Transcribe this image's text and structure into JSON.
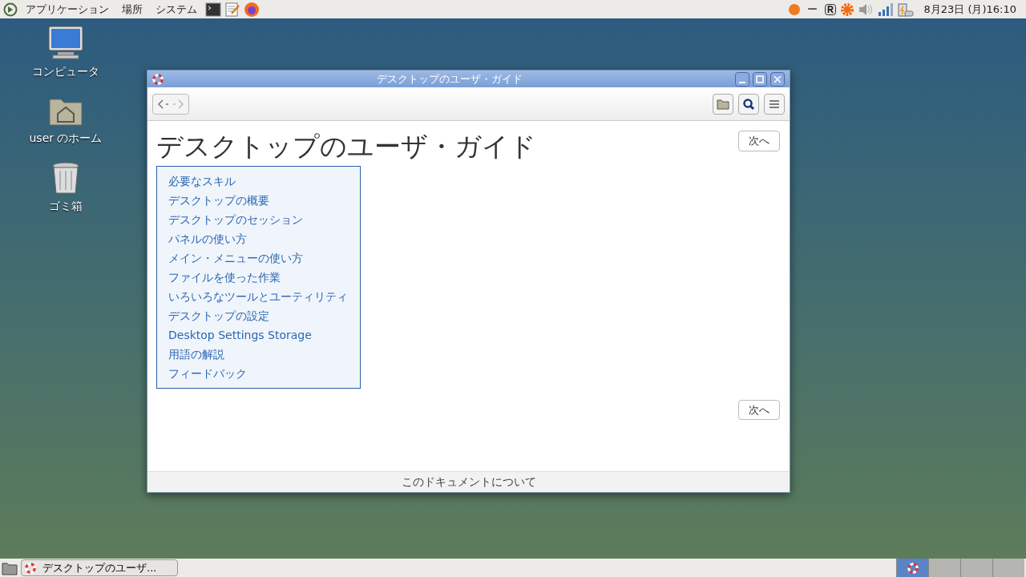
{
  "top_panel": {
    "menus": [
      "アプリケーション",
      "場所",
      "システム"
    ],
    "input_indicator": "ー",
    "clock": "8月23日 (月)16:10"
  },
  "desktop_icons": [
    {
      "kind": "computer",
      "label": "コンピュータ"
    },
    {
      "kind": "home",
      "label": "user のホーム"
    },
    {
      "kind": "trash",
      "label": "ゴミ箱"
    }
  ],
  "window": {
    "title": "デスクトップのユーザ・ガイド",
    "heading": "デスクトップのユーザ・ガイド",
    "next_top": "次へ",
    "next_bottom": "次へ",
    "links": [
      "必要なスキル",
      "デスクトップの概要",
      "デスクトップのセッション",
      "パネルの使い方",
      "メイン・メニューの使い方",
      "ファイルを使った作業",
      "いろいろなツールとユーティリティ",
      "デスクトップの設定",
      "Desktop Settings Storage",
      "用語の解説",
      "フィードバック"
    ],
    "footer": "このドキュメントについて"
  },
  "taskbar": {
    "tasks": [
      {
        "label": "デスクトップのユーザ...",
        "selected": false
      }
    ],
    "workspaces": [
      {
        "selected": true
      },
      {
        "selected": false
      },
      {
        "selected": false
      },
      {
        "selected": false
      }
    ]
  }
}
